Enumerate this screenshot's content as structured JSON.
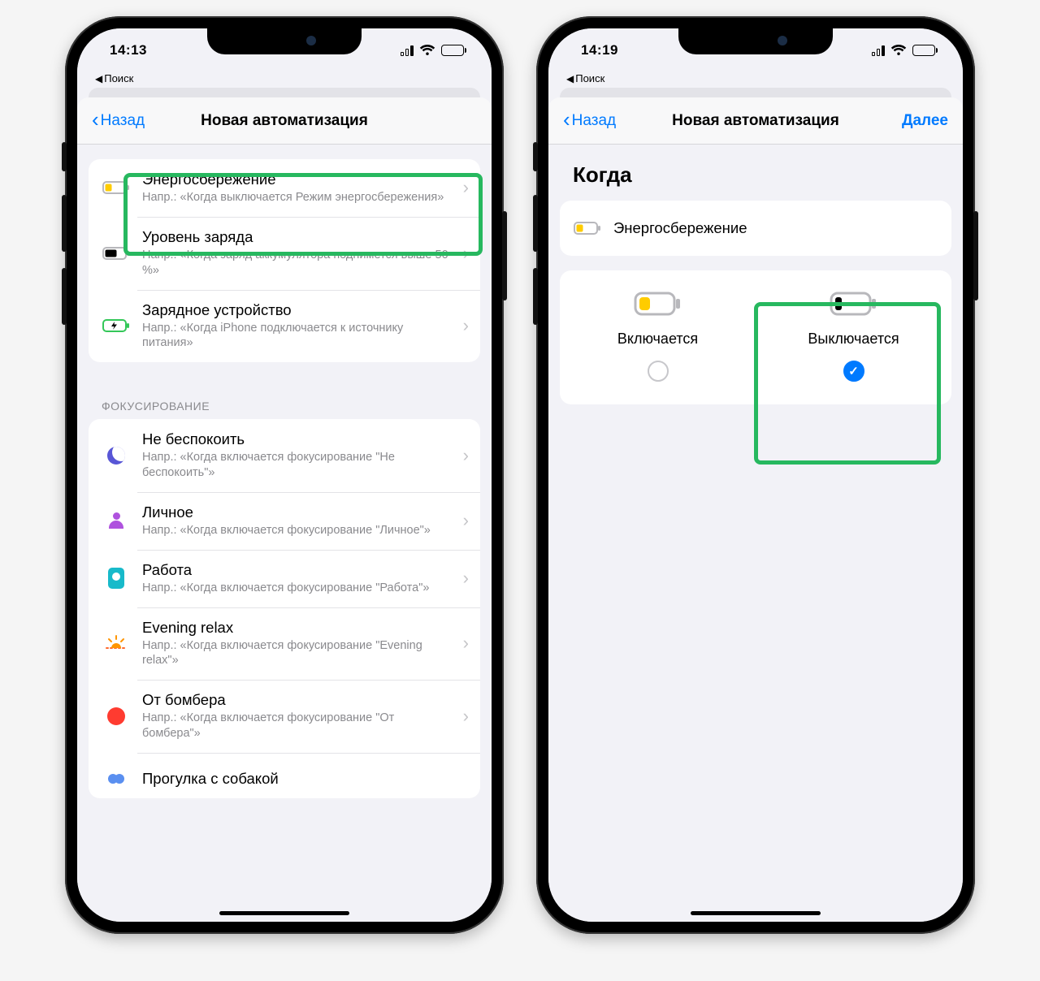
{
  "left": {
    "time": "14:13",
    "crumb": "Поиск",
    "nav_back": "Назад",
    "nav_title": "Новая автоматизация",
    "rows": [
      {
        "title": "Энергосбережение",
        "sub": "Напр.: «Когда выключается Режим энергосбережения»"
      },
      {
        "title": "Уровень заряда",
        "sub": "Напр.: «Когда заряд аккумулятора поднимется выше 50 %»"
      },
      {
        "title": "Зарядное устройство",
        "sub": "Напр.: «Когда iPhone подключается к источнику питания»"
      }
    ],
    "focus_header": "ФОКУСИРОВАНИЕ",
    "focus_rows": [
      {
        "title": "Не беспокоить",
        "sub": "Напр.: «Когда включается фокусирование \"Не беспокоить\"»"
      },
      {
        "title": "Личное",
        "sub": "Напр.: «Когда включается фокусирование \"Личное\"»"
      },
      {
        "title": "Работа",
        "sub": "Напр.: «Когда включается фокусирование \"Работа\"»"
      },
      {
        "title": "Evening relax",
        "sub": "Напр.: «Когда включается фокусирование \"Evening relax\"»"
      },
      {
        "title": "От бомбера",
        "sub": "Напр.: «Когда включается фокусирование \"От бомбера\"»"
      },
      {
        "title": "Прогулка с собакой",
        "sub": ""
      }
    ]
  },
  "right": {
    "time": "14:19",
    "crumb": "Поиск",
    "nav_back": "Назад",
    "nav_title": "Новая автоматизация",
    "nav_next": "Далее",
    "section": "Когда",
    "selected_row": "Энергосбережение",
    "choice_on": "Включается",
    "choice_off": "Выключается"
  }
}
